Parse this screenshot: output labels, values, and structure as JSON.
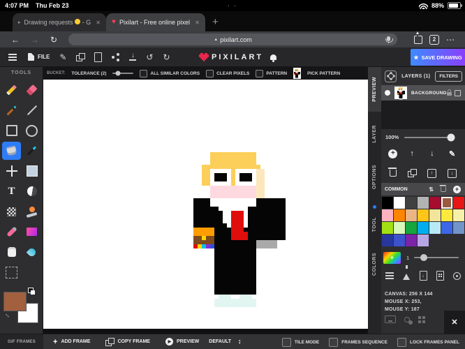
{
  "status_bar": {
    "time": "4:07 PM",
    "date": "Thu Feb 23",
    "battery_percent": "88%"
  },
  "browser": {
    "tab_inactive_title": "Drawing requests",
    "tab_inactive_suffix": "- G",
    "tab_active_title": "Pixilart - Free online pixel",
    "url": "pixilart.com",
    "tab_count": "2"
  },
  "icons": {
    "back": "←",
    "forward": "→",
    "reload": "↻",
    "more": "⋯",
    "close": "✕",
    "undo": "↺",
    "redo": "↻",
    "edit_pencil": "✎",
    "plus": "+",
    "arrow_up": "↑",
    "arrow_down": "↓",
    "sort": "⇅",
    "star": "★",
    "heart": "♥",
    "play": "▶",
    "tab_favicon": "▸",
    "tri_up": "▲",
    "tri_down": "▼",
    "resize": "↔",
    "download": "↓",
    "new_tab": "+"
  },
  "app_toolbar": {
    "file_label": "FILE",
    "brand": "PIXILART",
    "save_label": "SAVE DRAWING"
  },
  "options_bar": {
    "tool_label": "BUCKET:",
    "tolerance_label": "TOLERANCE (2)",
    "checkbox1": "ALL SIMILAR COLORS",
    "checkbox2": "CLEAR PIXELS",
    "checkbox3": "PATTERN",
    "pick_pattern_label": "PICK PATTERN"
  },
  "tools_panel": {
    "title": "TOOLS",
    "tools": [
      {
        "name": "pencil"
      },
      {
        "name": "eraser"
      },
      {
        "name": "brush"
      },
      {
        "name": "line"
      },
      {
        "name": "rectangle"
      },
      {
        "name": "ellipse"
      },
      {
        "name": "bucket",
        "selected": true
      },
      {
        "name": "color-picker"
      },
      {
        "name": "move"
      },
      {
        "name": "select"
      },
      {
        "name": "text"
      },
      {
        "name": "lighten"
      },
      {
        "name": "dither"
      },
      {
        "name": "stamp"
      },
      {
        "name": "smudge"
      },
      {
        "name": "gradient"
      },
      {
        "name": "pan"
      },
      {
        "name": "blur"
      },
      {
        "name": "crop"
      }
    ],
    "primary_color": "#a2603f",
    "secondary_color": "#ffffff"
  },
  "right_tabs": {
    "tab1": "PREVIEW",
    "tab2": "LAYER",
    "tab3": "OPTIONS",
    "tab4": "TOOL",
    "tab5": "COLORS"
  },
  "layers_panel": {
    "title": "LAYERS (1)",
    "filters_label": "FILTERS",
    "layer_name": "BACKGROUND",
    "opacity_label": "100%",
    "palette_group_label": "COMMON",
    "opacity_value": "1",
    "canvas_info": "CANVAS: 256 X 144",
    "mouse_x_info": "MOUSE X: 253,",
    "mouse_y_info": "MOUSE Y: 187",
    "palette": [
      "#000000",
      "#ffffff",
      "#404040",
      "#b3b3b3",
      "#a60d2e",
      "#9c5a3f",
      "#e81515",
      "#ffb3c1",
      "#ff8400",
      "#eab584",
      "#ffc61a",
      "#f2e49b",
      "#ffe93d",
      "#f7f0a8",
      "#a3e012",
      "#d8f7b8",
      "#16a53f",
      "#00aeef",
      "#b8e9f5",
      "#3d66e8",
      "#7295c9",
      "#27379e",
      "#3d52cc",
      "#7b24a8",
      "#b7a6e4"
    ],
    "selected_color_index": 5
  },
  "frames_bar": {
    "section_label": "GIF FRAMES",
    "add_label": "ADD FRAME",
    "copy_label": "COPY FRAME",
    "preview_label": "PREVIEW",
    "frames_mode": "DEFAULT",
    "checkbox_tile": "TILE MODE",
    "checkbox_sequence": "FRAMES SEQUENCE",
    "checkbox_lock": "LOCK FRAMES PANEL"
  },
  "artwork": {
    "colors": {
      "H": "#fccf5a",
      "W": "#ffffff",
      "K": "#050505",
      "P": "#ffd9e0",
      "S": "#fbe7bb",
      "R": "#e00d0d",
      "O": "#ff9d00",
      "B": "#7d4a1e",
      "Y": "#ffd400",
      "G": "#a9a9a9",
      "C": "#e2f6f1",
      "T": "#00c3e0",
      "U": "#8a2bd8",
      "L": "#2d4fe0"
    },
    "grid": [
      "......................",
      "......................",
      "....HHHHHHHHHHH.......",
      "....HHHHHHHHHHH.......",
      "....HHHHHHHHHHH.......",
      "..HHHHHHHHHHHHHH......",
      "..HHWWWWWHWWWWWSS.....",
      "..HHWKKKWHWKKKWSS.....",
      "..HHWKKKWHWKKKWSS.....",
      "..HHWWWWWHWWWWWSS.....",
      "....PPPPPPPPPPPSS.....",
      "....PPPPPPPPPPPSS.....",
      "....PPPPPPPPPPPSS.....",
      "KKKKWWWWWWWWWWWKKKKKKK",
      "KKKKWWWWWWWWWWWKKKKKKK",
      "KKKKKKWWWWWWWKKKKKKKKK",
      "KKKKKKKWWRRRWKKKKKKKKK",
      "KKKKKKKWWRRRWKKKKKKKKK",
      "KKKKKKKWWRRRWKKKKKKKKK",
      "KKKKKKKKWRRRWKKKKKKKKK",
      "OOOOOKKKKRRRKKKKKKKKKK",
      "OOOOOKKKKRRRRKKKKKKKKK",
      "BBYBBKKKKRRRRKKKKKKKKK",
      "BBBBBKKKKKKKKKKGGGGG..",
      "RYTULKKKKKKKKKKGGGGG..",
      ".....KKKKKKKKKK.......",
      ".....KKKKKKKKKK.......",
      ".....KKKKKKKKKK.......",
      ".....KKKKKKKKKK.......",
      ".....KKKKKKKKKK.......",
      ".....KKKKKKKKKK.......",
      ".....KKKKKKKKKK.......",
      ".....KKKKKKKKKK.......",
      ".....KKKKKKKKKK.......",
      ".....KKKKKKKKKK.......",
      ".....KKKKKKKKKK.......",
      "......CCC..CCC........",
      ".....CCCCCCCCCC.......",
      ".....CCCCCCCCCC.......",
      "......................"
    ]
  }
}
